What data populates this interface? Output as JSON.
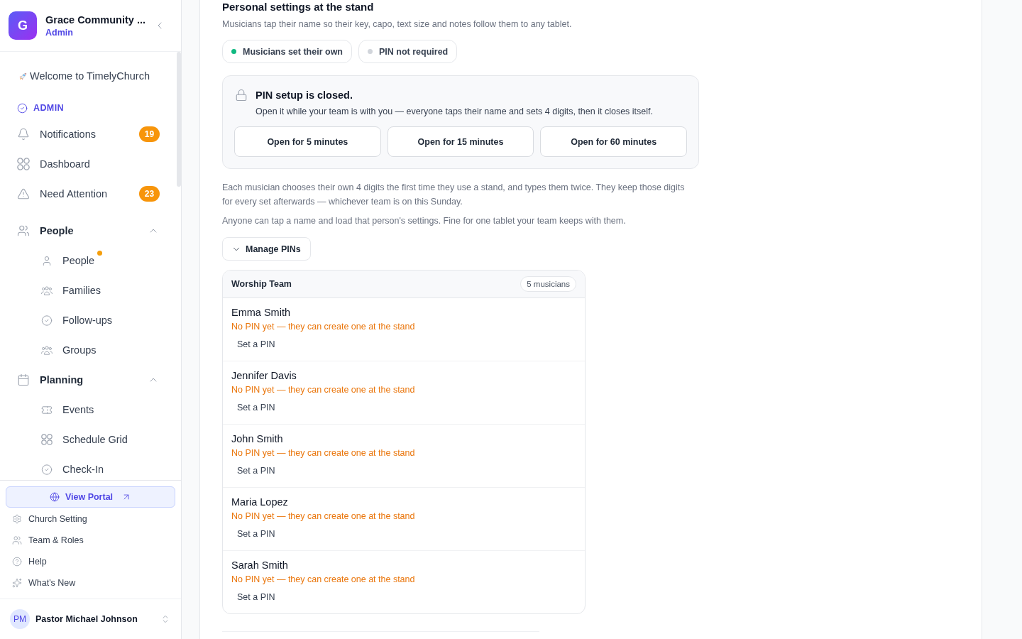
{
  "sidebar": {
    "org": {
      "initial": "G",
      "name": "Grace Community ...",
      "role": "Admin"
    },
    "welcome": "Welcome to TimelyChurch",
    "section": "ADMIN",
    "items": [
      {
        "label": "Notifications",
        "badge": "19"
      },
      {
        "label": "Dashboard"
      },
      {
        "label": "Need Attention",
        "badge": "23"
      }
    ],
    "groups": [
      {
        "label": "People",
        "expanded": true,
        "children": [
          {
            "label": "People",
            "unread": true
          },
          {
            "label": "Families",
            "unread": false
          },
          {
            "label": "Follow-ups",
            "unread": false
          },
          {
            "label": "Groups",
            "unread": false
          }
        ]
      },
      {
        "label": "Planning",
        "expanded": true,
        "children": [
          {
            "label": "Events",
            "unread": false
          },
          {
            "label": "Schedule Grid",
            "unread": false
          },
          {
            "label": "Check-In",
            "unread": false
          }
        ]
      }
    ],
    "portal_button": "View Portal",
    "links": [
      "Church Setting",
      "Team & Roles",
      "Help",
      "What's New"
    ],
    "user": {
      "initials": "PM",
      "name": "Pastor Michael Johnson"
    }
  },
  "main": {
    "title": "Personal settings at the stand",
    "description": "Musicians tap their name so their key, capo, text size and notes follow them to any tablet.",
    "chips": [
      {
        "label": "Musicians set their own",
        "color": "#10b981"
      },
      {
        "label": "PIN not required",
        "color": "#d1d5db"
      }
    ],
    "pin_setup": {
      "title": "PIN setup is closed.",
      "description": "Open it while your team is with you — everyone taps their name and sets 4 digits, then it closes itself.",
      "buttons": [
        "Open for 5 minutes",
        "Open for 15 minutes",
        "Open for 60 minutes"
      ]
    },
    "notes": [
      "Each musician chooses their own 4 digits the first time they use a stand, and types them twice. They keep those digits for every set afterwards — whichever team is on this Sunday.",
      "Anyone can tap a name and load that person's settings. Fine for one tablet your team keeps with them."
    ],
    "manage_pins": {
      "label": "Manage PINs",
      "expanded": true
    },
    "team": {
      "title": "Worship Team",
      "count": "5 musicians",
      "members": [
        {
          "name": "Emma Smith",
          "status": "No PIN yet — they can create one at the stand",
          "action": "Set a PIN"
        },
        {
          "name": "Jennifer Davis",
          "status": "No PIN yet — they can create one at the stand",
          "action": "Set a PIN"
        },
        {
          "name": "John Smith",
          "status": "No PIN yet — they can create one at the stand",
          "action": "Set a PIN"
        },
        {
          "name": "Maria Lopez",
          "status": "No PIN yet — they can create one at the stand",
          "action": "Set a PIN"
        },
        {
          "name": "Sarah Smith",
          "status": "No PIN yet — they can create one at the stand",
          "action": "Set a PIN"
        }
      ]
    }
  }
}
